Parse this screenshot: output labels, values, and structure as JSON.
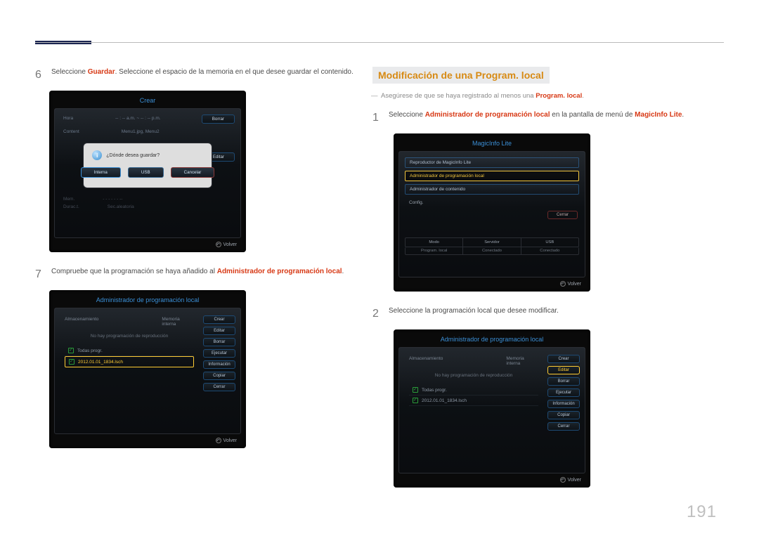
{
  "page_number": "191",
  "left": {
    "step6": {
      "num": "6",
      "pre": "Seleccione ",
      "hl": "Guardar",
      "post": ". Seleccione el espacio de la memoria en el que desee guardar el contenido."
    },
    "osd_crear": {
      "title": "Crear",
      "row1a": "Hora",
      "row1b": "-- : -- a.m. ~ -- : -- p.m.",
      "row2a": "Content",
      "row2b": "Menu1.jpg, Menu2",
      "row_borrar": "Borrar",
      "dialog_q": "¿Dónde desea guardar?",
      "btn_interna": "Interna",
      "btn_usb": "USB",
      "btn_cancel": "Cancelar",
      "dim1a": "Mem.",
      "dim1b": "- - - - - - --",
      "dim2a": "Durac.t.",
      "dim2b": "Sec.aleatoria",
      "editar": "Editar",
      "return": "Volver"
    },
    "step7": {
      "num": "7",
      "pre": "Compruebe que la programación se haya añadido al ",
      "hl": "Administrador de programación local",
      "post": "."
    },
    "osd_admin": {
      "title": "Administrador de programación local",
      "head_a": "Almacenamiento",
      "head_b": "Memoria interna",
      "msg": "No hay programación de reproducción",
      "item_all": "Todas progr.",
      "item_sel": "2012.01.01_1834.lsch",
      "side": [
        "Crear",
        "Editar",
        "Borrar",
        "Ejecutar",
        "Información",
        "Copiar",
        "Cerrar"
      ],
      "return": "Volver"
    }
  },
  "right": {
    "heading": "Modificación de una Program. local",
    "note_pre": "Asegúrese de que se haya registrado al menos una ",
    "note_hl": "Program. local",
    "note_post": ".",
    "step1": {
      "num": "1",
      "pre": "Seleccione ",
      "hl1": "Administrador de programación local",
      "mid": " en la pantalla de menú de ",
      "hl2": "MagicInfo Lite",
      "post": "."
    },
    "osd_mi": {
      "title": "MagicInfo Lite",
      "rows": [
        "Reproductor de MagicInfo Lite",
        "Administrador de programación local",
        "Administrador de contenido",
        "Config."
      ],
      "cerrar": "Cerrar",
      "grid_top": [
        "Modo",
        "Servidor",
        "USB"
      ],
      "grid_bot": [
        "Program. local",
        "Conectado",
        "Conectado"
      ],
      "return": "Volver"
    },
    "step2": {
      "num": "2",
      "text": "Seleccione la programación local que desee modificar."
    },
    "osd_admin2": {
      "title": "Administrador de programación local",
      "head_a": "Almacenamiento",
      "head_b": "Memoria interna",
      "msg": "No hay programación de reproducción",
      "item_all": "Todas progr.",
      "item_sel": "2012.01.01_1834.lsch",
      "side": [
        "Crear",
        "Editar",
        "Borrar",
        "Ejecutar",
        "Información",
        "Copiar",
        "Cerrar"
      ],
      "selected_side": "Editar",
      "return": "Volver"
    }
  }
}
